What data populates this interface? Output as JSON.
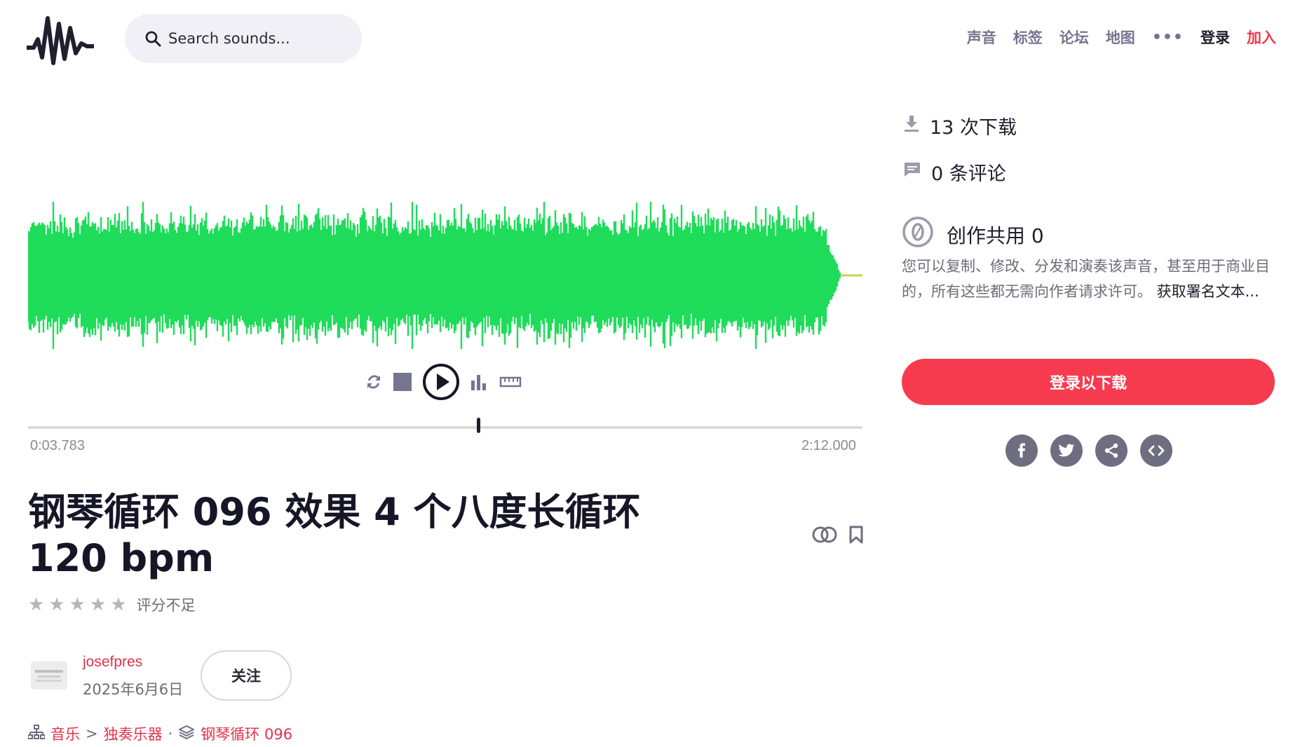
{
  "header": {
    "search_placeholder": "Search sounds...",
    "nav": [
      "声音",
      "标签",
      "论坛",
      "地图"
    ],
    "more": "•••",
    "login": "登录",
    "join": "加入"
  },
  "player": {
    "current_time": "0:03.783",
    "total_time": "2:12.000",
    "progress_fraction": 0.538,
    "waveform_color": "#1fdc5a"
  },
  "sound": {
    "title": "钢琴循环 096 效果 4 个八度长循环 120 bpm",
    "stars": [
      "★",
      "★",
      "★",
      "★",
      "★"
    ],
    "rating_text": "评分不足",
    "author": "josefpres",
    "date": "2025年6月6日",
    "follow_label": "关注",
    "breadcrumb": {
      "category": "音乐",
      "separator": ">",
      "subcategory": "独奏乐器",
      "dot": "·",
      "pack": "钢琴循环 096"
    }
  },
  "sidebar": {
    "downloads": "13 次下载",
    "comments": "0 条评论",
    "license_title": "创作共用 0",
    "license_desc": "您可以复制、修改、分发和演奏该声音，甚至用于商业目的，所有这些都无需向作者请求许可。",
    "attribution_link": "获取署名文本...",
    "download_button": "登录以下载"
  },
  "colors": {
    "accent": "#f73b4f",
    "link": "#e0344a",
    "waveform": "#1fdc5a",
    "icon_gray": "#6e6e80"
  },
  "icons": [
    "logo-waveform-icon",
    "search-icon",
    "loop-icon",
    "stop-icon",
    "play-icon",
    "spectrogram-icon",
    "ruler-icon",
    "similar-sounds-icon",
    "bookmark-icon",
    "download-icon",
    "comment-icon",
    "cc0-icon",
    "facebook-icon",
    "twitter-icon",
    "share-icon",
    "embed-icon",
    "category-tree-icon",
    "pack-icon"
  ]
}
